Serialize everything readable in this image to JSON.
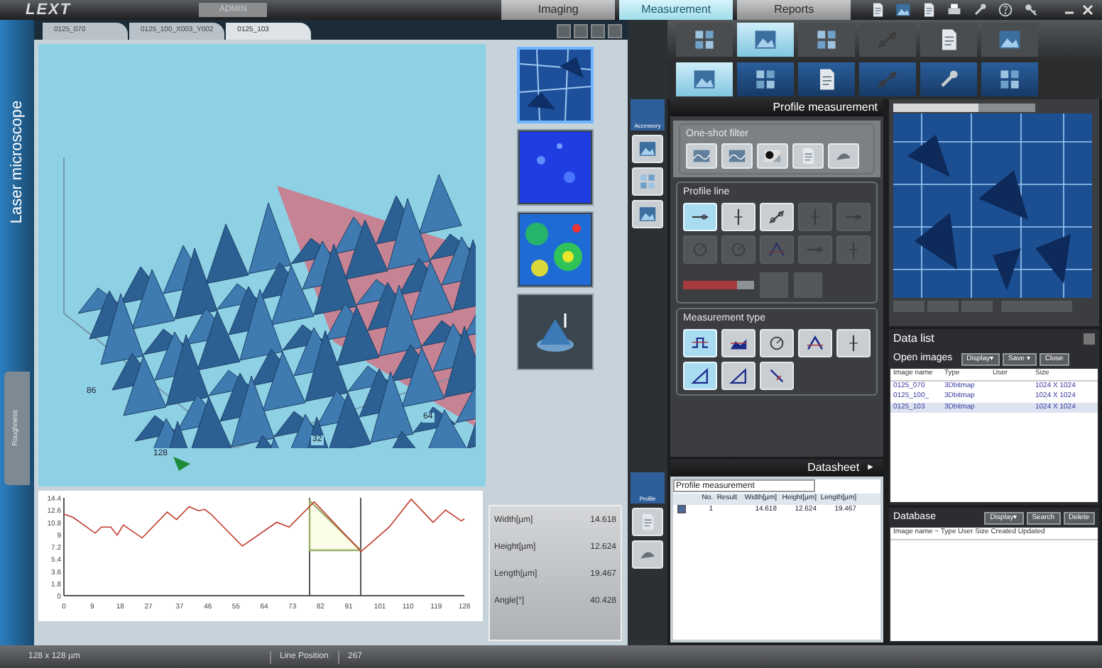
{
  "app": {
    "logo": "LEXT",
    "user": "ADMIN"
  },
  "mode_tabs": [
    {
      "label": "Imaging",
      "selected": false
    },
    {
      "label": "Measurement",
      "selected": true
    },
    {
      "label": "Reports",
      "selected": false
    }
  ],
  "toolbar_rows": [
    {
      "buttons": [
        {
          "selected": false
        },
        {
          "selected": true
        },
        {
          "selected": false
        },
        {
          "selected": false
        },
        {
          "selected": false
        },
        {
          "selected": false
        }
      ]
    },
    {
      "buttons": [
        {
          "selected": true
        },
        {
          "selected": false
        },
        {
          "selected": false
        },
        {
          "selected": false
        },
        {
          "selected": false
        },
        {
          "selected": false
        }
      ]
    }
  ],
  "side_label": "Laser microscope",
  "side_tab": "Roughness",
  "image_tabs": [
    {
      "label": "0125_070",
      "selected": false
    },
    {
      "label": "0125_100_X003_Y002",
      "selected": false
    },
    {
      "label": "0125_103",
      "selected": true
    }
  ],
  "view_3d": {
    "axis_labels": [
      "86",
      "128",
      "32",
      "64"
    ]
  },
  "thumbnails": [
    {
      "kind": "texture",
      "selected": true
    },
    {
      "kind": "intensity",
      "selected": false
    },
    {
      "kind": "height",
      "selected": false
    },
    {
      "kind": "surface",
      "selected": false
    }
  ],
  "profile_chart": {
    "chart_data": {
      "type": "line",
      "xlim": [
        0,
        128
      ],
      "ylim": [
        0,
        14.4
      ],
      "xticks": [
        0,
        9,
        18,
        27,
        37,
        46,
        55,
        64,
        73,
        82,
        91,
        101,
        110,
        119,
        128
      ],
      "yticks": [
        0,
        1.8,
        3.6,
        5.4,
        7.2,
        9.0,
        10.8,
        12.6,
        14.4
      ],
      "x": [
        0,
        3,
        10,
        12,
        15,
        17,
        19,
        25,
        33,
        36,
        40,
        43,
        45,
        47,
        57,
        58,
        68,
        72,
        80,
        95,
        104,
        111,
        118,
        122,
        127,
        128
      ],
      "series": [
        {
          "color": "#c0392b",
          "values": [
            12.0,
            11.5,
            9.2,
            10.1,
            10.1,
            8.9,
            10.4,
            8.5,
            12.3,
            11.2,
            13.1,
            12.5,
            12.7,
            12.0,
            7.3,
            7.6,
            10.8,
            10.1,
            13.8,
            6.5,
            10.1,
            14.2,
            10.8,
            12.6,
            11.0,
            11.3
          ]
        }
      ]
    }
  },
  "results": [
    {
      "label": "Width[µm]",
      "value": "14.618"
    },
    {
      "label": "Height[µm]",
      "value": "12.624"
    },
    {
      "label": "Length[µm]",
      "value": "19.467"
    },
    {
      "label": "Angle[°]",
      "value": "40.428"
    }
  ],
  "accessory_tab": {
    "label": "Accessory",
    "selected": true
  },
  "profile_tab": {
    "label": "Profile",
    "selected": true
  },
  "profile_panel": {
    "title": "Profile measurement",
    "filter": {
      "title": "One-shot filter"
    },
    "profile_line": {
      "title": "Profile line",
      "tools": [
        {
          "selected": true,
          "disabled": false
        },
        {
          "selected": false,
          "disabled": false
        },
        {
          "selected": false,
          "disabled": false
        },
        {
          "selected": false,
          "disabled": true
        },
        {
          "selected": false,
          "disabled": true
        },
        {
          "selected": false,
          "disabled": true
        },
        {
          "selected": false,
          "disabled": true
        },
        {
          "selected": false,
          "disabled": true
        },
        {
          "selected": false,
          "disabled": true
        },
        {
          "selected": false,
          "disabled": true
        }
      ],
      "width_slider": {
        "level": 0.75
      }
    },
    "measurement_type": {
      "title": "Measurement type",
      "tools": [
        {
          "selected": true
        },
        {
          "selected": false
        },
        {
          "selected": false
        },
        {
          "selected": false
        },
        {
          "selected": false
        },
        {
          "selected": true
        },
        {
          "selected": false
        },
        {
          "selected": false
        }
      ]
    }
  },
  "datasheet": {
    "title": "Datasheet",
    "arrow": "►",
    "selector": "Profile measurement",
    "columns": [
      "No.",
      "Result",
      "Width[µm]",
      "Height[µm]",
      "Length[µm]"
    ],
    "rows": [
      {
        "checked": true,
        "cells": [
          "1",
          "",
          "14.618",
          "12.624",
          "19.467"
        ]
      }
    ]
  },
  "data_list": {
    "title": "Data list",
    "open_images": {
      "title": "Open images",
      "buttons": [
        "Display▾",
        "Save ▾",
        "Close"
      ],
      "columns": [
        "Image name",
        "Type",
        "User",
        "Size"
      ],
      "rows": [
        {
          "selected": false,
          "cells": [
            "0125_070",
            "3Dbitmap",
            "",
            "1024 X 1024"
          ]
        },
        {
          "selected": false,
          "cells": [
            "0125_100_",
            "3Dbitmap",
            "",
            "1024 X 1024"
          ]
        },
        {
          "selected": true,
          "cells": [
            "0125_103",
            "3Dbitmap",
            "",
            "1024 X 1024"
          ]
        }
      ]
    }
  },
  "database": {
    "title": "Database",
    "buttons": [
      "Display▾",
      "Search",
      "Delete"
    ],
    "header": "Image name ~ Type User Size Created Updated"
  },
  "status_bar": [
    "128 x 128 µm",
    "Line Position",
    "267"
  ]
}
